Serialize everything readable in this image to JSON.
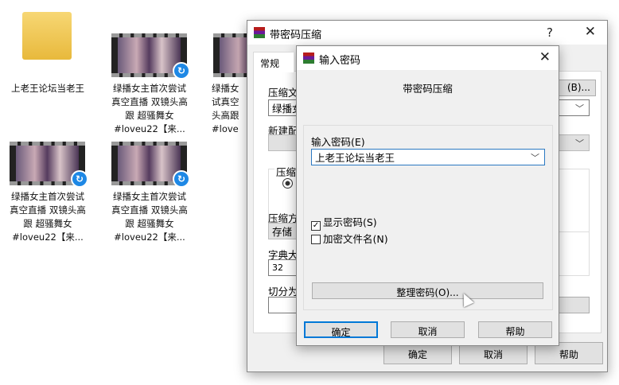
{
  "desktop": {
    "folder_label": "上老王论坛当老王",
    "videos": [
      {
        "label": "绿播女主首次尝试真空直播 双镜头高跟 超骚舞女#loveu22【来..."
      },
      {
        "label": "绿播女",
        "label_full": "绿播女试真空头高跟#love"
      },
      {
        "label": "绿播女主首次尝试真空直播 双镜头高跟 超骚舞女#loveu22【来..."
      },
      {
        "label": "绿播女主首次尝试真空直播 双镜头高跟 超骚舞女#loveu22【来..."
      }
    ]
  },
  "main_dialog": {
    "title": "带密码压缩",
    "help": "?",
    "close": "✕",
    "tab": "常规",
    "archive_label": "压缩文",
    "archive_value": "绿播女",
    "browse": "(B)...",
    "profile_label": "新建配",
    "format_label": "压缩",
    "method_label": "压缩方",
    "method_value": "存储",
    "dict_label": "字典大",
    "dict_value": "32",
    "split_label": "切分为",
    "ok": "确定",
    "cancel": "取消",
    "help_btn": "帮助"
  },
  "password_dialog": {
    "title": "输入密码",
    "close": "✕",
    "heading": "带密码压缩",
    "password_label": "输入密码(E)",
    "password_value": "上老王论坛当老王",
    "show_password": {
      "label": "显示密码(S)",
      "checked": true
    },
    "encrypt_names": {
      "label": "加密文件名(N)",
      "checked": false
    },
    "organize": "整理密码(O)...",
    "ok": "确定",
    "cancel": "取消",
    "help": "帮助"
  }
}
